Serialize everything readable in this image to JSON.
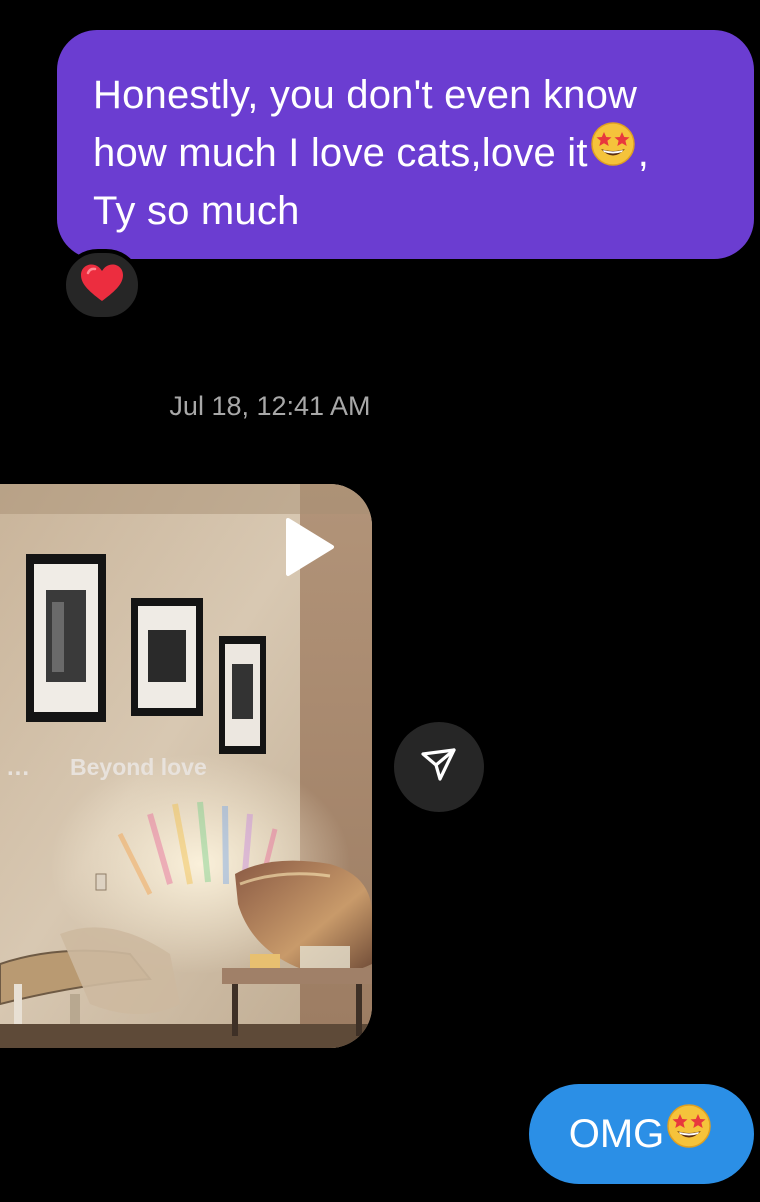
{
  "messages": {
    "sent_top": {
      "line1": "Honestly, you don't even know",
      "line2_text": "how much I love cats,love it",
      "line2_suffix": ",",
      "line3": "Ty so much",
      "emoji": "star-struck-emoji",
      "reaction": "heart-reaction"
    },
    "timestamp": "Jul 18, 12:41 AM",
    "received_media": {
      "type": "reel",
      "caption_dots": "...",
      "caption": "Beyond love",
      "play_icon": "play-icon",
      "share_icon": "share-send-icon"
    },
    "sent_bottom": {
      "text": "OMG",
      "emoji": "star-struck-emoji"
    }
  },
  "colors": {
    "background": "#000000",
    "sent_bubble_purple": "#6b3dd1",
    "sent_bubble_blue": "#2b8fe6",
    "reaction_bg": "#262626",
    "timestamp": "#a8a8a8"
  }
}
